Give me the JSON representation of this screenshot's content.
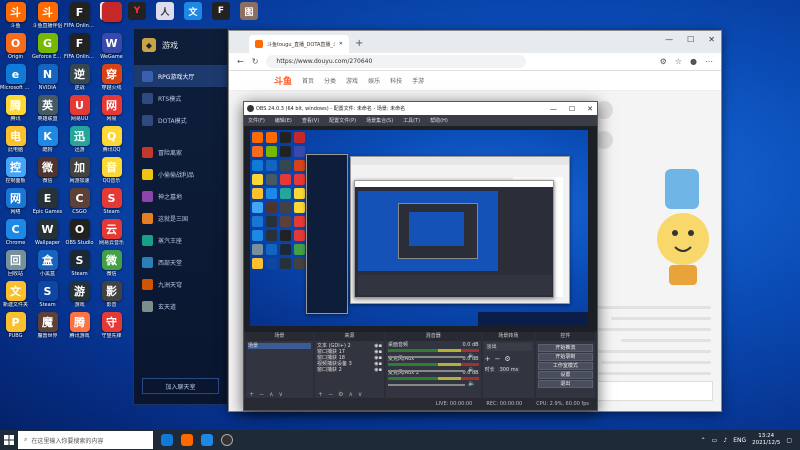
{
  "desktop": {
    "icons": [
      {
        "label": "斗鱼",
        "color": "#ff6a00",
        "glyph": "斗"
      },
      {
        "label": "斗鱼直播伴侣",
        "color": "#ff6a00",
        "glyph": "斗"
      },
      {
        "label": "FIFA Online 4",
        "color": "#222222",
        "glyph": "F"
      },
      {
        "label": "",
        "color": "#c62828",
        "glyph": ""
      },
      {
        "label": "Origin",
        "color": "#f56c1d",
        "glyph": "O"
      },
      {
        "label": "Geforce Experience",
        "color": "#76b900",
        "glyph": "G"
      },
      {
        "label": "FIFA Online 4",
        "color": "#222222",
        "glyph": "F"
      },
      {
        "label": "WeGame",
        "color": "#3949ab",
        "glyph": "W"
      },
      {
        "label": "Microsoft Edge",
        "color": "#0f7bd6",
        "glyph": "e"
      },
      {
        "label": "NVIDIA",
        "color": "#1565c0",
        "glyph": "N"
      },
      {
        "label": "逆战",
        "color": "#37474f",
        "glyph": "逆"
      },
      {
        "label": "穿越火线",
        "color": "#d84315",
        "glyph": "穿"
      },
      {
        "label": "腾讯",
        "color": "#fdd835",
        "glyph": "腾"
      },
      {
        "label": "英雄联盟",
        "color": "#455a64",
        "glyph": "英"
      },
      {
        "label": "网易UU",
        "color": "#e53935",
        "glyph": "U"
      },
      {
        "label": "网易",
        "color": "#e53935",
        "glyph": "网"
      },
      {
        "label": "此电脑",
        "color": "#fbc02d",
        "glyph": "电"
      },
      {
        "label": "酷狗",
        "color": "#1e88e5",
        "glyph": "K"
      },
      {
        "label": "迅游",
        "color": "#26a69a",
        "glyph": "迅"
      },
      {
        "label": "腾讯QQ",
        "color": "#fdd835",
        "glyph": "Q"
      },
      {
        "label": "控制面板",
        "color": "#42a5f5",
        "glyph": "控"
      },
      {
        "label": "微信",
        "color": "#4e342e",
        "glyph": "微"
      },
      {
        "label": "网游加速",
        "color": "#424242",
        "glyph": "加"
      },
      {
        "label": "QQ音乐",
        "color": "#fdd835",
        "glyph": "音"
      },
      {
        "label": "网络",
        "color": "#1976d2",
        "glyph": "网"
      },
      {
        "label": "Epic Games",
        "color": "#263238",
        "glyph": "E"
      },
      {
        "label": "CSGO",
        "color": "#5d4037",
        "glyph": "C"
      },
      {
        "label": "Steam",
        "color": "#e53935",
        "glyph": "S"
      },
      {
        "label": "Chrome",
        "color": "#1e88e5",
        "glyph": "C"
      },
      {
        "label": "Wallpaper",
        "color": "#263238",
        "glyph": "W"
      },
      {
        "label": "OBS Studio",
        "color": "#212121",
        "glyph": "O"
      },
      {
        "label": "网易云音乐",
        "color": "#e53935",
        "glyph": "云"
      },
      {
        "label": "回收站",
        "color": "#78909c",
        "glyph": "回"
      },
      {
        "label": "小黑盒",
        "color": "#1565c0",
        "glyph": "盒"
      },
      {
        "label": "Steam",
        "color": "#1b2838",
        "glyph": "S"
      },
      {
        "label": "微信",
        "color": "#43a047",
        "glyph": "微"
      },
      {
        "label": "新建文件夹",
        "color": "#fbc02d",
        "glyph": "文"
      },
      {
        "label": "Steam",
        "color": "#0d47a1",
        "glyph": "S"
      },
      {
        "label": "游戏",
        "color": "#263238",
        "glyph": "游"
      },
      {
        "label": "影音",
        "color": "#424242",
        "glyph": "影"
      },
      {
        "label": "PUBG",
        "color": "#fbc02d",
        "glyph": "P"
      },
      {
        "label": "魔兽世界",
        "color": "#5d4037",
        "glyph": "魔"
      },
      {
        "label": "腾讯游戏",
        "color": "#ff7043",
        "glyph": "腾"
      },
      {
        "label": "守望先锋",
        "color": "#e53935",
        "glyph": "守"
      }
    ]
  },
  "launcher": {
    "title": "游戏",
    "items": [
      {
        "label": "RPG游戏大厅",
        "active": true,
        "color": "#3a5fb0"
      },
      {
        "label": "RTS模式",
        "active": false,
        "color": "#2f4a80"
      },
      {
        "label": "DOTA模式",
        "active": false,
        "color": "#2f4a80"
      },
      {
        "label": "冒险离家",
        "active": false,
        "color": "#c0392b"
      },
      {
        "label": "小偷偷战利品",
        "active": false,
        "color": "#f1c40f"
      },
      {
        "label": "神之墓地",
        "active": false,
        "color": "#8e44ad"
      },
      {
        "label": "这就是三国",
        "active": false,
        "color": "#e67e22"
      },
      {
        "label": "蒸汽王座",
        "active": false,
        "color": "#16a085"
      },
      {
        "label": "西部天堂",
        "active": false,
        "color": "#2980b9"
      },
      {
        "label": "九洲天穹",
        "active": false,
        "color": "#d35400"
      },
      {
        "label": "玄天道",
        "active": false,
        "color": "#7f8c8d"
      }
    ],
    "footer": "加入聊天室"
  },
  "browser": {
    "tab_title": "斗鱼tougu_直播_DOTA直播_斗",
    "url": "https://www.douyu.com/270640",
    "site_nav": [
      "首页",
      "分类",
      "游戏",
      "娱乐",
      "科技",
      "手游"
    ]
  },
  "obs": {
    "title": "OBS 24.0.3 (64 bit, windows) - 配置文件: 未命名 - 场景: 未命名",
    "menu": [
      "文件(F)",
      "编辑(E)",
      "查看(V)",
      "配置文件(P)",
      "场景集合(S)",
      "工具(T)",
      "帮助(H)"
    ],
    "docks": {
      "scenes": {
        "title": "场景",
        "items": [
          "场景"
        ]
      },
      "sources": {
        "title": "来源",
        "items": [
          "文本 (GDI+) 2",
          "窗口捕获 17",
          "窗口捕获 18",
          "视频捕获设备 3",
          "窗口捕获 2"
        ]
      },
      "mixer": {
        "title": "混音器",
        "channels": [
          {
            "name": "桌面音频",
            "level": "0.0 dB"
          },
          {
            "name": "麦克风/Aux",
            "level": "0.0 dB"
          },
          {
            "name": "麦克风/Aux 2",
            "level": "0.0 dB"
          }
        ]
      },
      "transitions": {
        "title": "场景转场",
        "type": "淡出",
        "duration_label": "时长",
        "duration": "300 ms"
      },
      "controls": {
        "title": "控件",
        "buttons": [
          "开始推流",
          "开始录制",
          "工作室模式",
          "设置",
          "退出"
        ]
      }
    },
    "status": {
      "live": "LIVE: 00:00:00",
      "rec": "REC: 00:00:00",
      "cpu": "CPU: 2.9%, 60.00 fps"
    }
  },
  "taskbar": {
    "search_placeholder": "在这里输入你要搜索的内容",
    "lang": "ENG",
    "time": "13:24",
    "date": "2021/12/5"
  }
}
